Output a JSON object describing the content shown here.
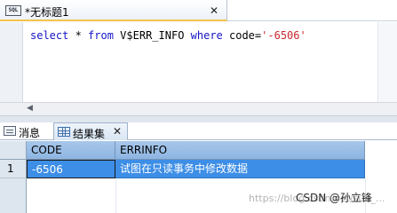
{
  "editor": {
    "tab": {
      "icon_text": "SQL",
      "title": "*无标题1",
      "close_glyph": "✕"
    },
    "sql": {
      "select": "select",
      "star": " * ",
      "from": "from",
      "table": " V$ERR_INFO ",
      "where": "where",
      "condition": " code=",
      "literal": "'-6506'"
    },
    "scroll_arrow": "◀"
  },
  "results": {
    "tabs": [
      {
        "label": "消息",
        "icon": "message-icon",
        "active": false
      },
      {
        "label": "结果集",
        "icon": "grid-icon",
        "active": true,
        "close_glyph": "✕"
      }
    ],
    "columns": [
      "CODE",
      "ERRINFO"
    ],
    "rows": [
      {
        "num": "1",
        "code": "-6506",
        "errinfo": "试图在只读事务中修改数据",
        "selected": true
      }
    ]
  },
  "watermark": "https://blog.csdn.net/sun_...",
  "credit": "CSDN @孙立锋",
  "colors": {
    "keyword": "#1515c7",
    "string": "#c9282d",
    "selection": "#3d8ee6",
    "header": "#8db5e2"
  }
}
